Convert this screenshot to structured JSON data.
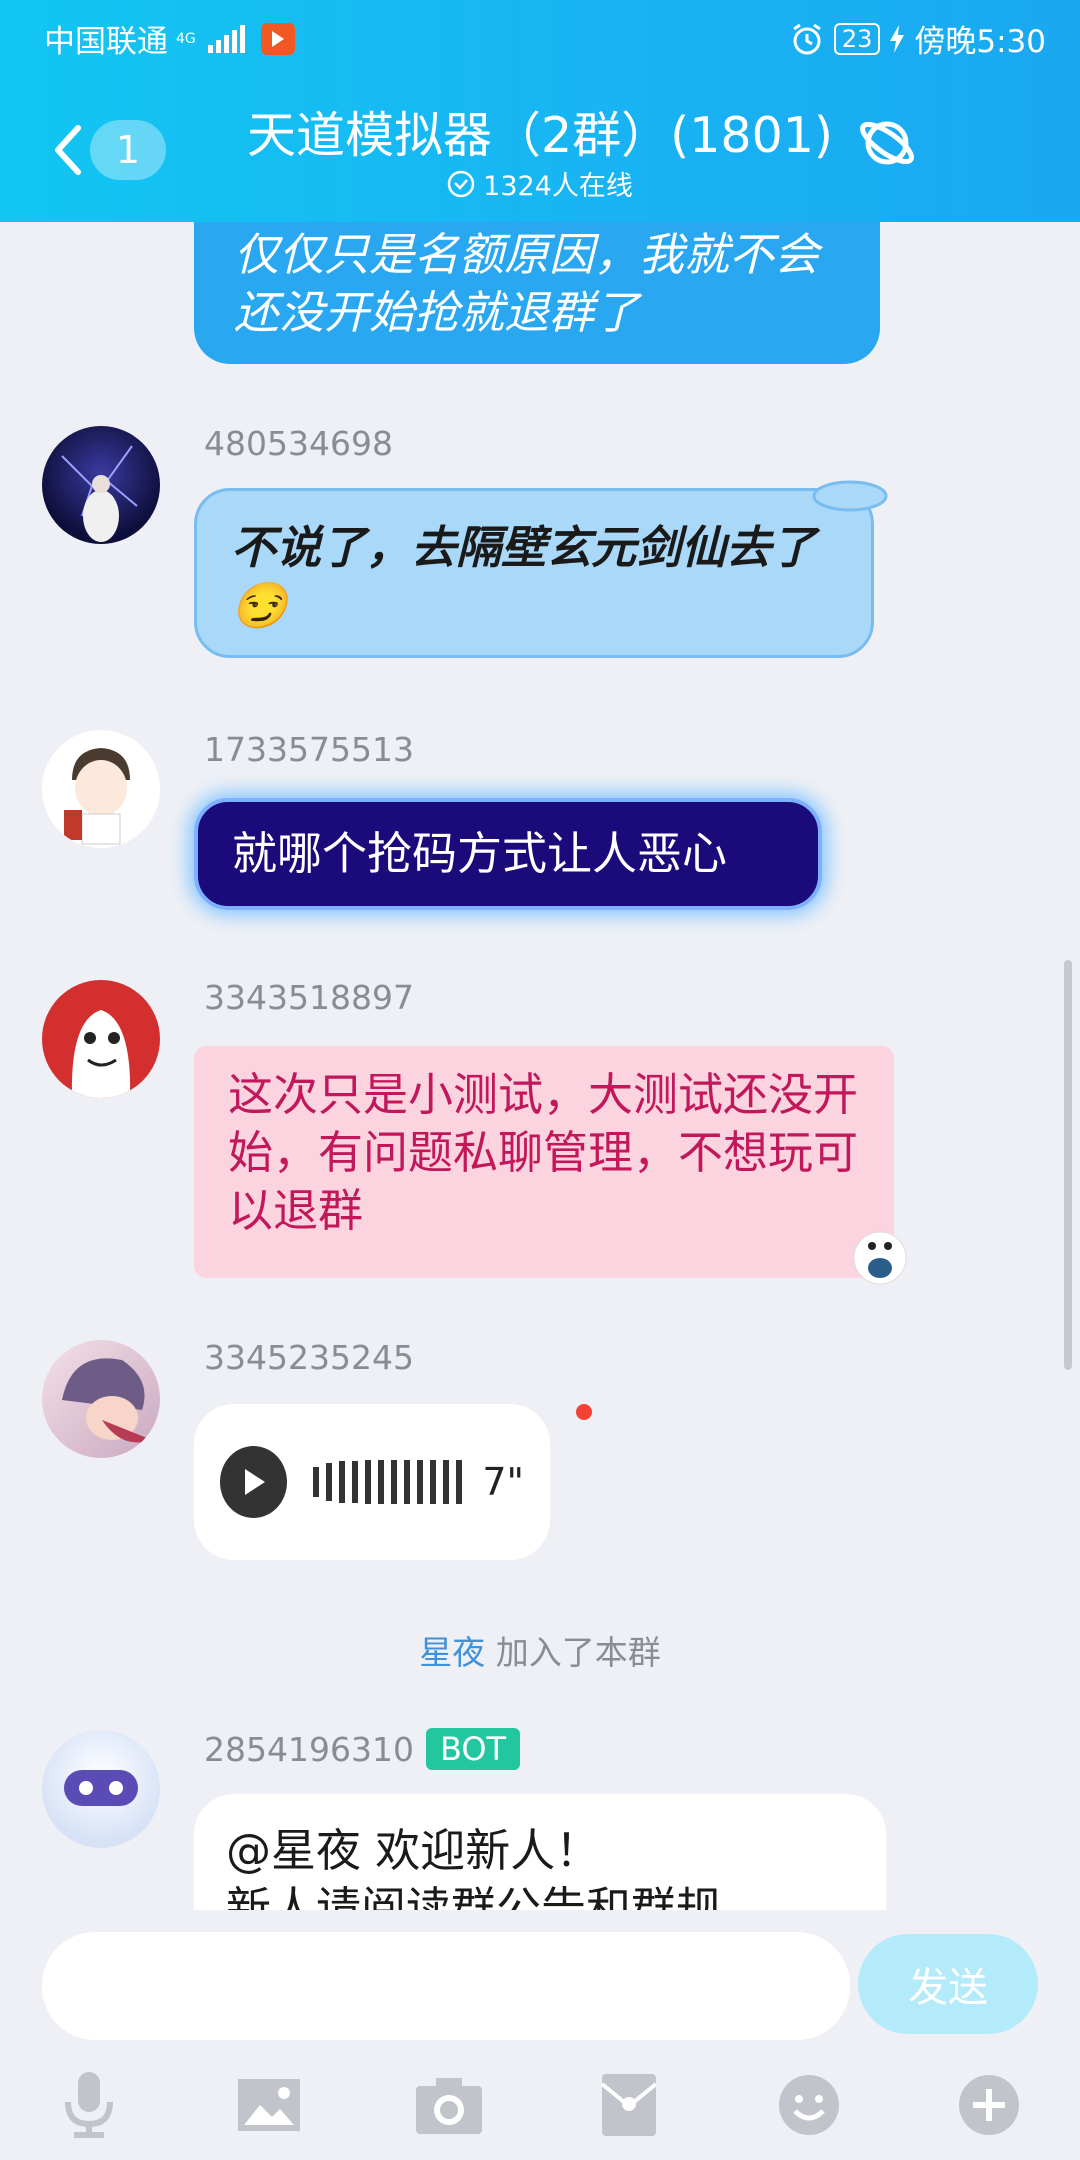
{
  "status_bar": {
    "carrier": "中国联通",
    "network": "4G",
    "battery": "23",
    "time": "傍晚5:30"
  },
  "header": {
    "unread_count": "1",
    "title": "天道模拟器（2群）(1801)",
    "online": "1324人在线"
  },
  "messages": [
    {
      "text": "仅仅只是名额原因，我就不会还没开始抢就退群了"
    },
    {
      "sender": "480534698",
      "text": "不说了，去隔壁玄元剑仙去了",
      "emoji": "😏"
    },
    {
      "sender": "1733575513",
      "text": "就哪个抢码方式让人恶心"
    },
    {
      "sender": "3343518897",
      "text": "这次只是小测试，大测试还没开始，有问题私聊管理，不想玩可以退群"
    },
    {
      "sender": "3345235245",
      "voice_duration": "7\""
    },
    {
      "sender": "2854196310",
      "badge": "BOT",
      "text": "@星夜 欢迎新人！",
      "text2": "新人请阅读群公告和群规"
    }
  ],
  "system": {
    "name": "星夜",
    "action": "加入了本群"
  },
  "input": {
    "send_label": "发送",
    "placeholder": ""
  },
  "toolbar": [
    "mic-icon",
    "image-icon",
    "camera-icon",
    "redpacket-icon",
    "emoji-icon",
    "plus-icon"
  ],
  "colors": {
    "header": "#18b4f3",
    "accent": "#3f92d8",
    "bot_badge": "#22c7a0"
  }
}
